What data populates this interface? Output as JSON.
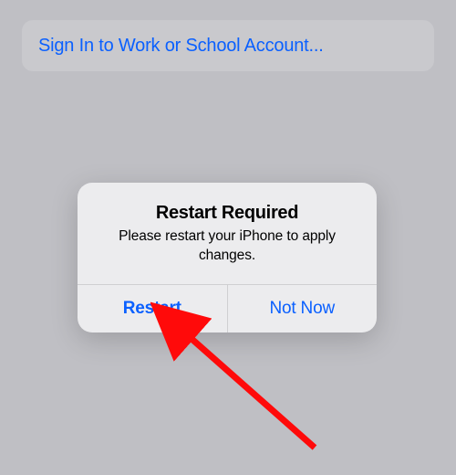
{
  "topCell": {
    "label": "Sign In to Work or School Account..."
  },
  "alert": {
    "title": "Restart Required",
    "message": "Please restart your iPhone to apply changes.",
    "primaryButton": "Restart",
    "secondaryButton": "Not Now"
  },
  "annotation": {
    "arrowColor": "#ff0a0a"
  }
}
